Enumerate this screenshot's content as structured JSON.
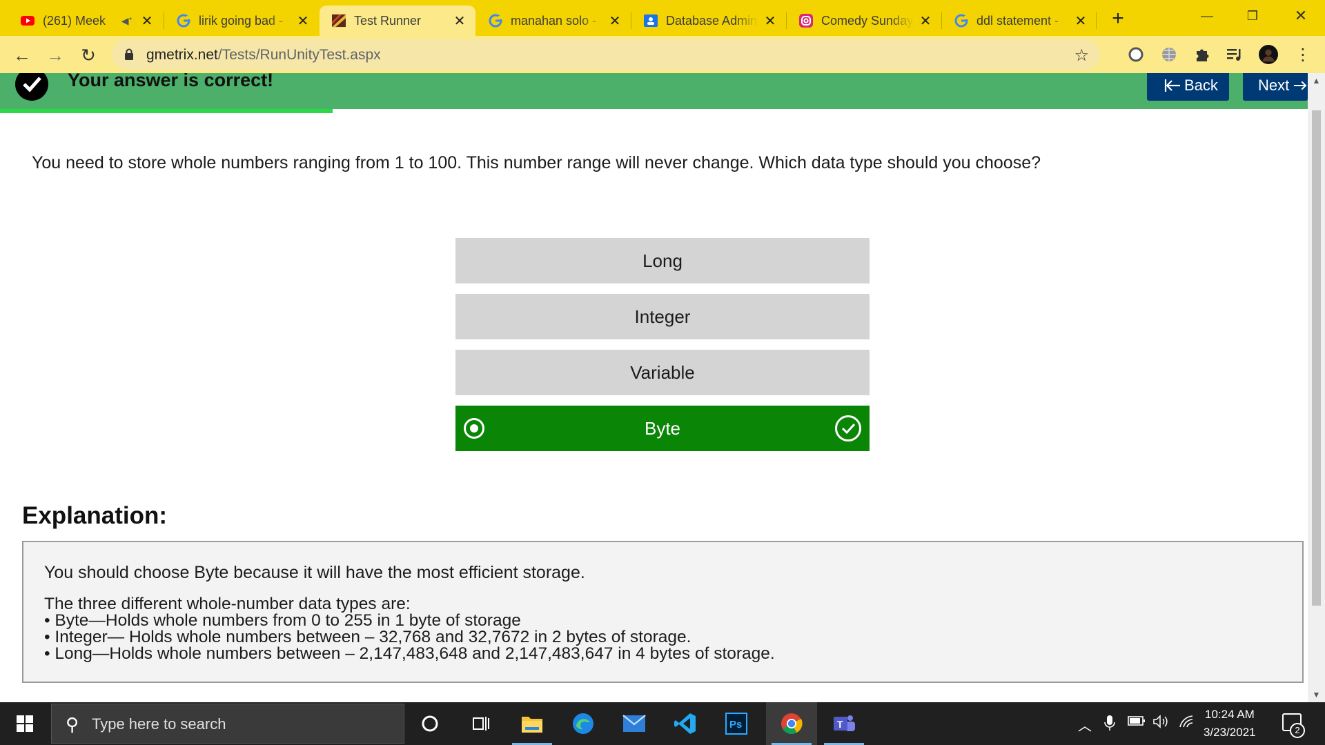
{
  "browser": {
    "tabs": [
      {
        "title": "(261) Meek",
        "favicon": "youtube-icon",
        "muted_icon": "speaker-icon"
      },
      {
        "title": "lirik going bad - ",
        "favicon": "google-icon"
      },
      {
        "title": "Test Runner",
        "favicon": "gmetrix-icon",
        "active": true
      },
      {
        "title": "manahan solo - ",
        "favicon": "google-icon"
      },
      {
        "title": "Database Admin",
        "favicon": "database-admin-icon"
      },
      {
        "title": "Comedy Sunday",
        "favicon": "instagram-icon"
      },
      {
        "title": "ddl statement - ",
        "favicon": "google-icon"
      }
    ],
    "url_host": "gmetrix.net",
    "url_path": "/Tests/RunUnityTest.aspx",
    "theme_color": "#f3d400"
  },
  "page": {
    "status_message": "Your answer is correct!",
    "back_label": "Back",
    "next_label": "Next",
    "question": "You need to store whole numbers ranging from 1 to 100. This number range will never change. Which data type should you choose?",
    "answers": [
      {
        "label": "Long"
      },
      {
        "label": "Integer"
      },
      {
        "label": "Variable"
      },
      {
        "label": "Byte",
        "selected": true,
        "correct": true
      }
    ],
    "explanation_heading": "Explanation:",
    "explanation_main": "You should choose Byte because it will have the most efficient storage.",
    "explanation_intro": "The three different whole-number data types are:",
    "explanation_items": [
      "• Byte—Holds whole numbers from 0 to 255 in 1 byte of storage",
      "• Integer— Holds whole numbers between – 32,768 and 32,7672 in 2 bytes of storage.",
      "• Long—Holds whole numbers between – 2,147,483,648 and 2,147,483,647 in 4 bytes of storage."
    ],
    "colors": {
      "banner": "#4caf6a",
      "correct": "#0a8506",
      "nav_button": "#003a75",
      "answer": "#d4d4d4"
    }
  },
  "taskbar": {
    "search_placeholder": "Type here to search",
    "time": "10:24 AM",
    "date": "3/23/2021",
    "notification_count": "2",
    "apps": [
      "cortana-icon",
      "task-view-icon",
      "file-explorer-icon",
      "edge-icon",
      "mail-icon",
      "vscode-icon",
      "photoshop-icon",
      "chrome-icon",
      "teams-icon"
    ]
  }
}
